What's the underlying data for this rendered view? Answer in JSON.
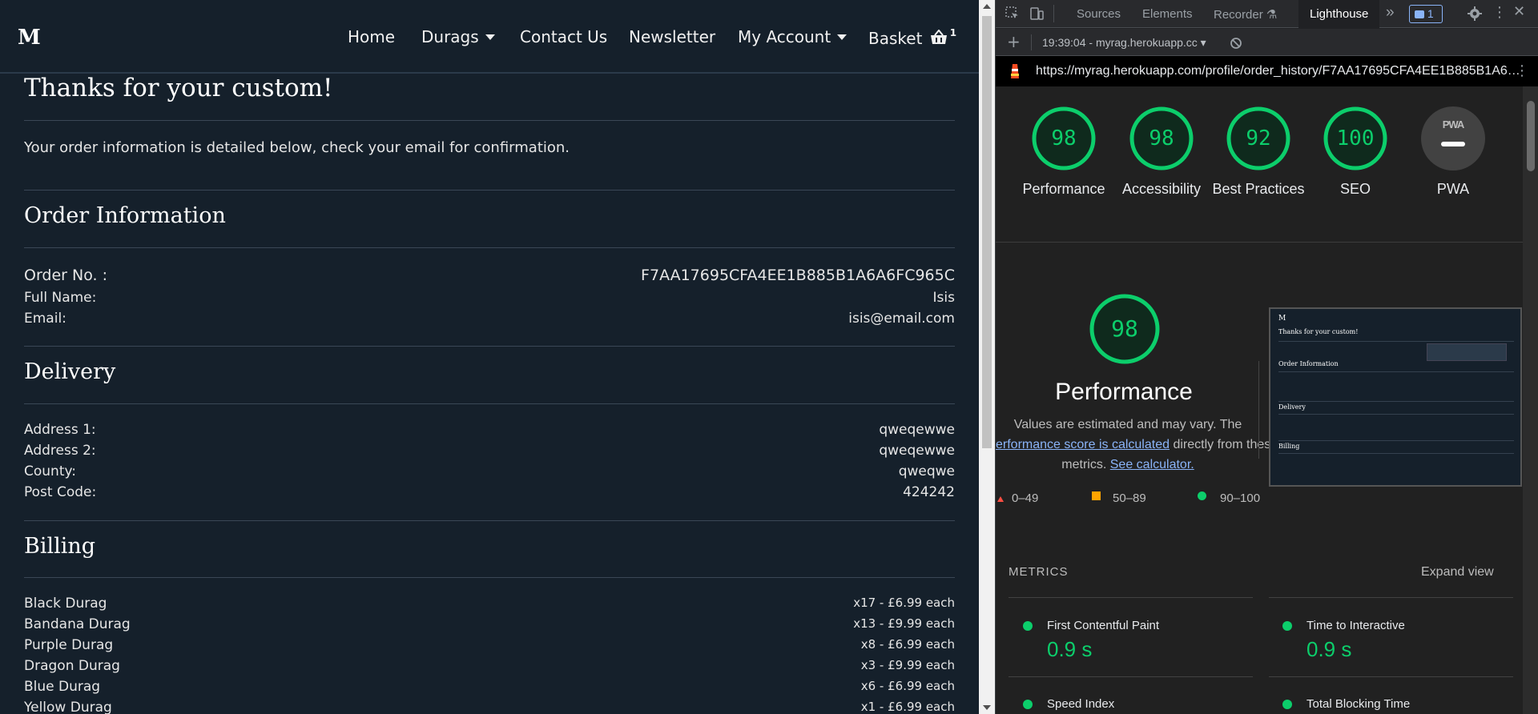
{
  "site": {
    "logo": "M",
    "nav": {
      "home": "Home",
      "durags": "Durags",
      "contact": "Contact Us",
      "newsletter": "Newsletter",
      "account": "My Account",
      "basket": "Basket",
      "basket_count": "1"
    },
    "title": "Thanks for your custom!",
    "lead": "Your order information is detailed below, check your email for confirmation.",
    "order_heading": "Order Information",
    "order": [
      {
        "label": "Order No. :",
        "value": "F7AA17695CFA4EE1B885B1A6A6FC965C"
      },
      {
        "label": "Full Name:",
        "value": "Isis"
      },
      {
        "label": "Email:",
        "value": "isis@email.com"
      }
    ],
    "delivery_heading": "Delivery",
    "delivery": [
      {
        "label": "Address 1:",
        "value": "qweqewwe"
      },
      {
        "label": "Address 2:",
        "value": "qweqewwe"
      },
      {
        "label": "County:",
        "value": "qweqwe"
      },
      {
        "label": "Post Code:",
        "value": "424242"
      }
    ],
    "billing_heading": "Billing",
    "billing": [
      {
        "label": "Black Durag",
        "value": "x17 - £6.99 each"
      },
      {
        "label": "Bandana Durag",
        "value": "x13 - £9.99 each"
      },
      {
        "label": "Purple Durag",
        "value": "x8 - £6.99 each"
      },
      {
        "label": "Dragon Durag",
        "value": "x3 - £9.99 each"
      },
      {
        "label": "Blue Durag",
        "value": "x6 - £6.99 each"
      },
      {
        "label": "Yellow Durag",
        "value": "x1 - £6.99 each"
      }
    ]
  },
  "devtools": {
    "tabs": {
      "sources": "Sources",
      "elements": "Elements",
      "recorder": "Recorder",
      "lighthouse": "Lighthouse",
      "more": "»"
    },
    "issues_count": "1",
    "report_label": "19:39:04 - myrag.herokuapp.cc",
    "url": "https://myrag.herokuapp.com/profile/order_history/F7AA17695CFA4EE1B885B1A6…",
    "scores": [
      {
        "label": "Performance",
        "value": "98"
      },
      {
        "label": "Accessibility",
        "value": "98"
      },
      {
        "label": "Best Practices",
        "value": "92"
      },
      {
        "label": "SEO",
        "value": "100"
      }
    ],
    "pwa": {
      "badge": "PWA",
      "label": "PWA"
    },
    "performance": {
      "score": "98",
      "title": "Performance",
      "desc_1": "Values are estimated and may vary. The",
      "desc_link": "erformance score is calculated",
      "desc_2": "directly from these",
      "desc_3": "metrics.",
      "desc_link2": "See calculator."
    },
    "legend": {
      "fail": "0–49",
      "average": "50–89",
      "pass": "90–100"
    },
    "colors": {
      "pass": "#0cce6b",
      "average": "#ffa400",
      "fail": "#ff4e42"
    },
    "metrics_title": "METRICS",
    "expand": "Expand view",
    "metrics": [
      {
        "name": "First Contentful Paint",
        "value": "0.9 s"
      },
      {
        "name": "Time to Interactive",
        "value": "0.9 s"
      },
      {
        "name": "Speed Index",
        "value": ""
      },
      {
        "name": "Total Blocking Time",
        "value": ""
      }
    ],
    "screenshot": {
      "title": "Thanks for your custom!",
      "order": "Order Information",
      "delivery": "Delivery",
      "billing": "Billing"
    }
  }
}
